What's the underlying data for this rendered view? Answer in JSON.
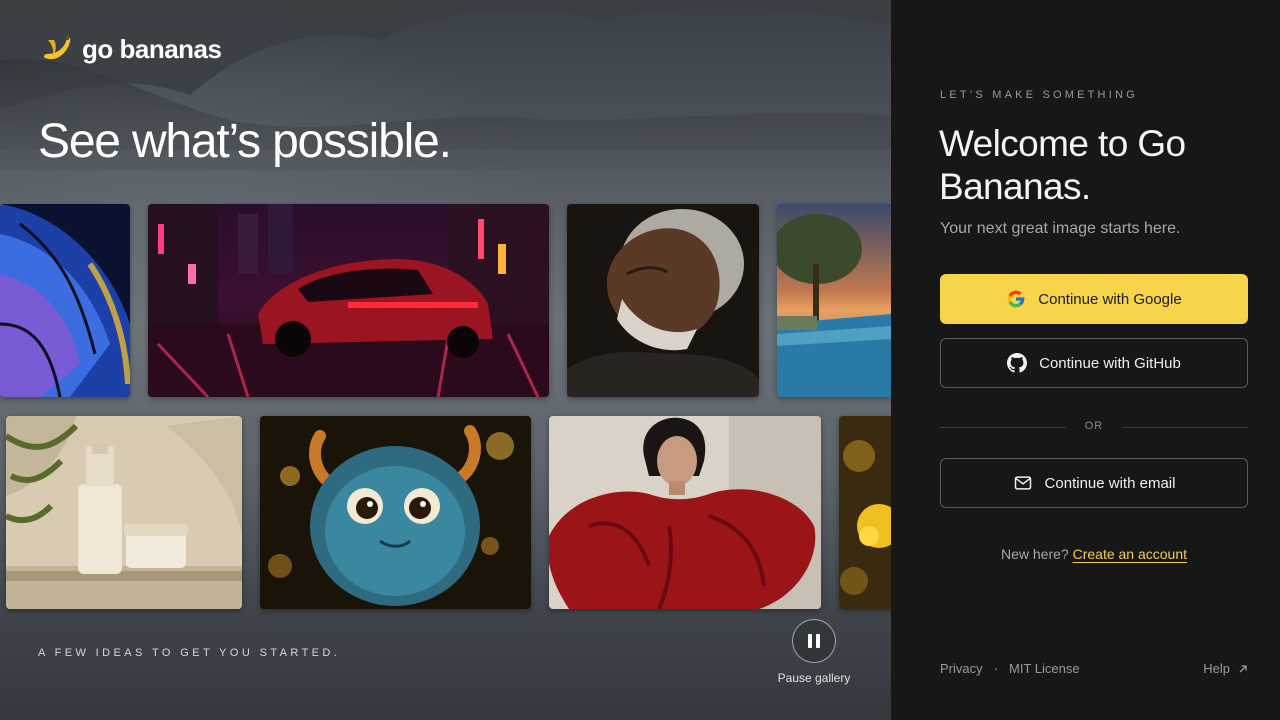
{
  "brand": {
    "name": "go bananas",
    "logo_icon": "banana-icon",
    "accent": "#f7d54a"
  },
  "hero": {
    "headline": "See what’s possible.",
    "caption": "A FEW IDEAS TO GET YOU STARTED.",
    "pause_label": "Pause gallery",
    "gallery": [
      "butterfly-wing-image",
      "neon-city-car-image",
      "elderly-man-portrait-image",
      "infinity-pool-tree-image",
      "cosmetics-product-image",
      "fluffy-monster-image",
      "red-dress-fashion-image",
      "golden-bokeh-image"
    ]
  },
  "auth": {
    "kicker": "LET’S MAKE SOMETHING",
    "title": "Welcome to Go Bananas.",
    "subtitle": "Your next great image starts here.",
    "google_label": "Continue with Google",
    "github_label": "Continue with GitHub",
    "or_label": "OR",
    "email_label": "Continue with email",
    "signup_prompt": "New here?",
    "signup_link": "Create an account"
  },
  "footer": {
    "privacy": "Privacy",
    "separator": "·",
    "license": "MIT License",
    "help": "Help"
  }
}
